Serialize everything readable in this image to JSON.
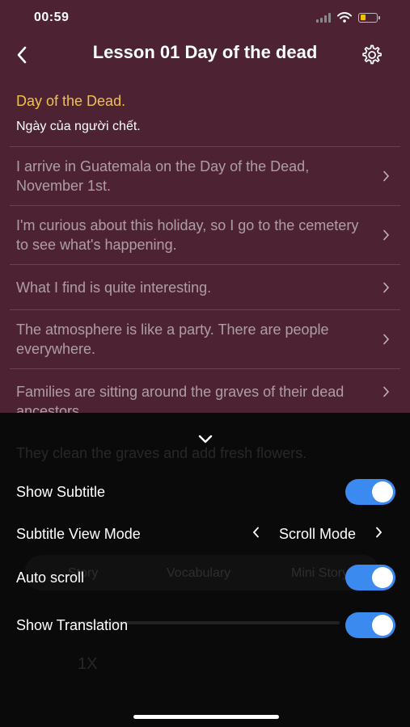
{
  "status": {
    "time": "00:59"
  },
  "header": {
    "title": "Lesson 01 Day of the dead",
    "icons": {
      "back": "chevron-left-icon",
      "settings": "gear-icon"
    }
  },
  "lesson": {
    "heading_en": "Day of the Dead.",
    "heading_vi": "Ngày của người chết.",
    "sentences": [
      "I arrive in Guatemala on the Day of the Dead, November 1st.",
      "I'm curious about this holiday, so I go to the cemetery to see what's happening.",
      "What I find is quite interesting.",
      "The atmosphere is like a party. There are people everywhere.",
      "Families are sitting around the graves of their dead ancestors."
    ]
  },
  "background_ghost": {
    "sentence": "They clean the graves and add fresh flowers.",
    "tabs": [
      "Story",
      "Vocabulary",
      "Mini Story"
    ],
    "speed": "1X"
  },
  "settings_sheet": {
    "show_subtitle": {
      "label": "Show Subtitle",
      "on": true
    },
    "view_mode": {
      "label": "Subtitle View Mode",
      "value": "Scroll Mode"
    },
    "auto_scroll": {
      "label": "Auto scroll",
      "on": true
    },
    "show_translation": {
      "label": "Show Translation",
      "on": true
    }
  },
  "colors": {
    "background": "#4d2334",
    "heading": "#efc04c",
    "toggle": "#3b8af0",
    "sheet": "#0a0a0a"
  }
}
